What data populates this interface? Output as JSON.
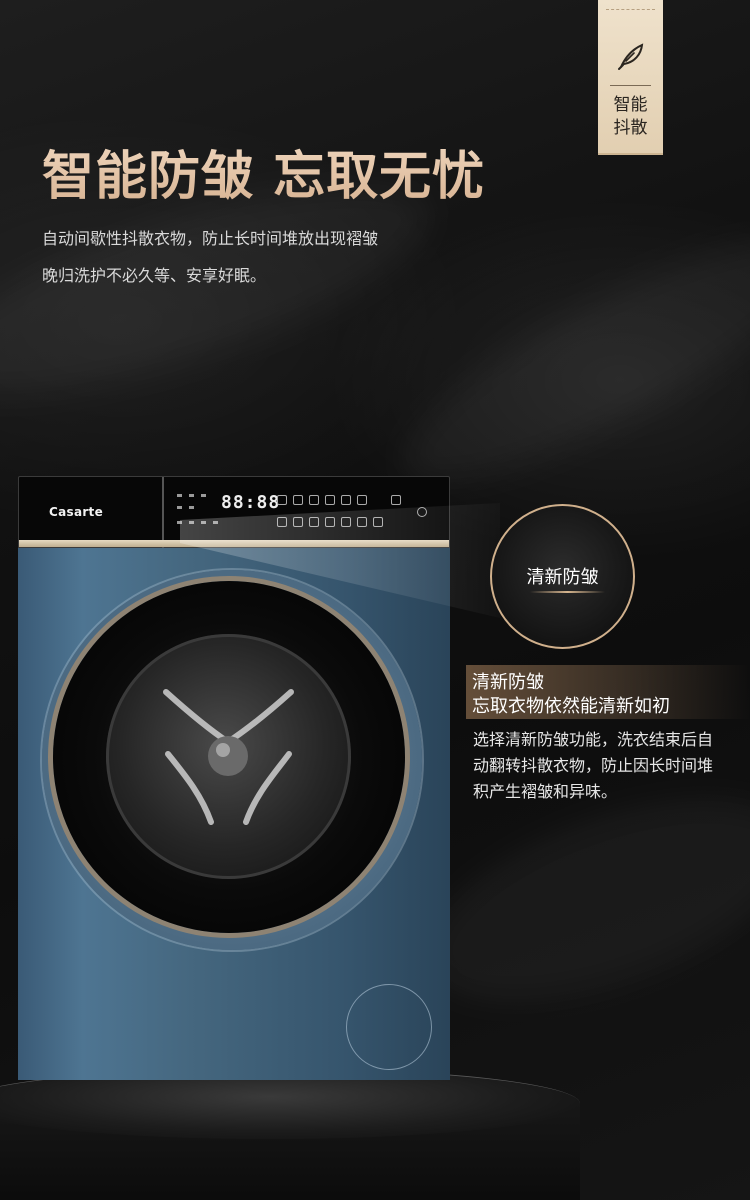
{
  "badge": {
    "label": "智能\n抖散",
    "icon": "feather-icon"
  },
  "headline": "智能防皱 忘取无忧",
  "intro": [
    "自动间歇性抖散衣物，防止长时间堆放出现褶皱",
    "晚归洗护不必久等、安享好眠。"
  ],
  "washer": {
    "brand": "Casarte",
    "display_digits": "88:88",
    "body_color": "#3f5f78",
    "trim_color": "#d8c8a8"
  },
  "callout": {
    "circle_label": "清新防皱",
    "title_lines": [
      "清新防皱",
      "忘取衣物依然能清新如初"
    ],
    "description": [
      "选择清新防皱功能，洗衣结束后自",
      "动翻转抖散衣物，防止因长时间堆",
      "积产生褶皱和异味。"
    ]
  },
  "colors": {
    "accent_gold": "#e2c3a3",
    "background": "#0f0f0f"
  }
}
